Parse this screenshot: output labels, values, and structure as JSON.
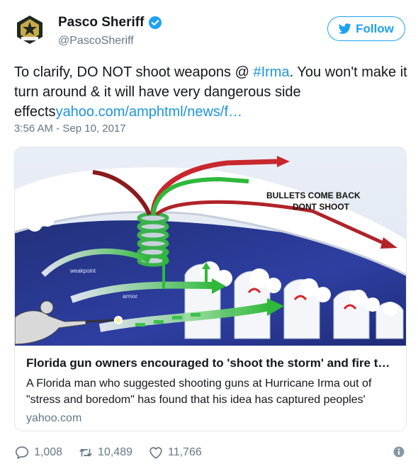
{
  "header": {
    "name": "Pasco Sheriff",
    "handle": "@PascoSheriff",
    "follow_label": "Follow"
  },
  "tweet": {
    "text_line1_before": "To clarify, DO NOT shoot weapons @ ",
    "hashtag": "#Irma",
    "text_rest": ". You won't make it turn around & it will have very dangerous side effects",
    "link": "yahoo.com/amphtml/news/f…",
    "timestamp": "3:56 AM - Sep 10, 2017"
  },
  "card": {
    "image_labels": {
      "bullets_line1": "BULLETS COME BACK",
      "bullets_line2": "DONT SHOOT",
      "weakpoint": "weakpoint",
      "armor": "armor"
    },
    "title": "Florida gun owners encouraged to 'shoot the storm' and fire t…",
    "description": "A Florida man who suggested shooting guns at Hurricane Irma out of \"stress and boredom\" has found that his idea has captured peoples'",
    "domain": "yahoo.com"
  },
  "actions": {
    "replies": "1,008",
    "retweets": "10,489",
    "likes": "11,766"
  },
  "colors": {
    "accent": "#1da1f2",
    "link": "#1b95e0",
    "muted": "#657786"
  }
}
